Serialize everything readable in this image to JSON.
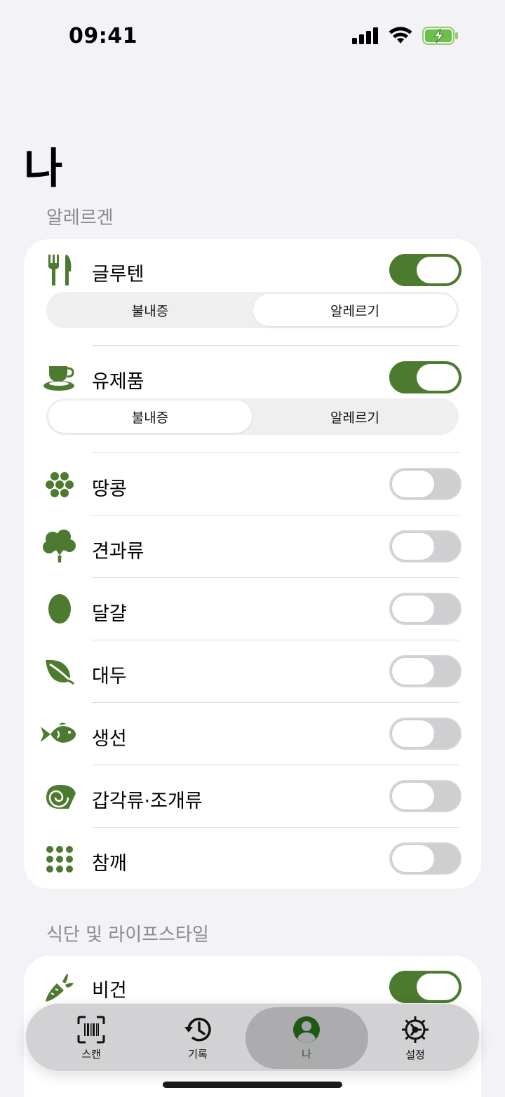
{
  "status": {
    "time": "09:41"
  },
  "page": {
    "title": "나"
  },
  "sections": {
    "allergens_header": "알레르겐",
    "diet_header": "식단 및 라이프스타일"
  },
  "allergens": [
    {
      "label": "글루텐",
      "icon": "fork-knife-icon",
      "on": true,
      "segment": {
        "options": [
          "불내증",
          "알레르기"
        ],
        "selected": 1
      }
    },
    {
      "label": "유제품",
      "icon": "cup-saucer-icon",
      "on": true,
      "segment": {
        "options": [
          "불내증",
          "알레르기"
        ],
        "selected": 0
      }
    },
    {
      "label": "땅콩",
      "icon": "peanut-cluster-icon",
      "on": false
    },
    {
      "label": "견과류",
      "icon": "tree-icon",
      "on": false
    },
    {
      "label": "달걀",
      "icon": "egg-icon",
      "on": false
    },
    {
      "label": "대두",
      "icon": "leaf-icon",
      "on": false
    },
    {
      "label": "생선",
      "icon": "fish-icon",
      "on": false
    },
    {
      "label": "갑각류·조개류",
      "icon": "shell-icon",
      "on": false
    },
    {
      "label": "참깨",
      "icon": "seeds-icon",
      "on": false
    }
  ],
  "diet": [
    {
      "label": "비건",
      "icon": "carrot-icon",
      "on": true
    }
  ],
  "tabs": [
    {
      "label": "스캔",
      "icon": "barcode-scan-icon",
      "active": false
    },
    {
      "label": "기록",
      "icon": "history-icon",
      "active": false
    },
    {
      "label": "나",
      "icon": "person-icon",
      "active": true
    },
    {
      "label": "설정",
      "icon": "gear-icon",
      "active": false
    }
  ],
  "colors": {
    "accent": "#4c7a2f",
    "background": "#f2f2f7",
    "toggle_off": "#cfcfd2"
  }
}
